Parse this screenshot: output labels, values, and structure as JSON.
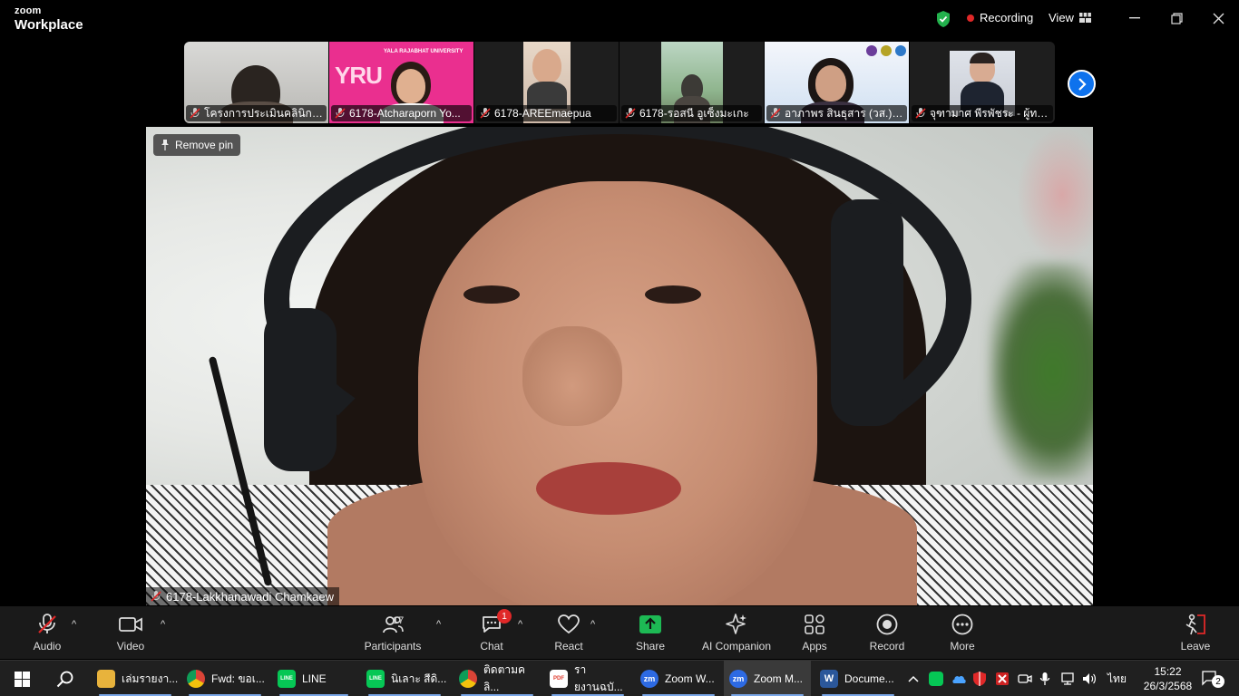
{
  "app": {
    "brand_top": "zoom",
    "brand_bottom": "Workplace"
  },
  "titlebar": {
    "recording_label": "Recording",
    "view_label": "View"
  },
  "gallery": {
    "tiles": [
      {
        "name": "โครงการประเมินคลินิกเทค..."
      },
      {
        "name": "6178-Atcharaporn Yo...",
        "banner_text": "YRU",
        "banner_small": "YALA RAJABHAT UNIVERSITY"
      },
      {
        "name": "6178-AREEmaepua"
      },
      {
        "name": "6178-รอสนี อูเซ็งมะเกะ"
      },
      {
        "name": "อาภาพร สินธุสาร (วส.)-..."
      },
      {
        "name": "จุฑามาศ พีรพัชระ - ผู้ทร..."
      }
    ]
  },
  "main_video": {
    "remove_pin_label": "Remove pin",
    "speaker_name": "6178-Lakkhanawadi Chamkaew"
  },
  "toolbar": {
    "audio": "Audio",
    "video": "Video",
    "participants": "Participants",
    "participants_count": "17",
    "chat": "Chat",
    "chat_badge": "1",
    "react": "React",
    "share": "Share",
    "ai_companion": "AI Companion",
    "apps": "Apps",
    "record": "Record",
    "more": "More",
    "leave": "Leave"
  },
  "taskbar": {
    "items": [
      {
        "label": "เล่มรายงา...",
        "icon": "folder-icon",
        "color": "#e8b33c"
      },
      {
        "label": "Fwd: ขอเ...",
        "icon": "chrome-icon",
        "color": "#db4437"
      },
      {
        "label": "LINE",
        "icon": "line-icon",
        "color": "#06c755"
      },
      {
        "label": "นิเลาะ สีดิ...",
        "icon": "line-icon",
        "color": "#06c755"
      },
      {
        "label": "ติดตามคลิ...",
        "icon": "chrome-icon",
        "color": "#db4437"
      },
      {
        "label": "รายงานฉบั...",
        "icon": "pdf-icon",
        "color": "#e03b2f"
      },
      {
        "label": "Zoom W...",
        "icon": "zoom-icon",
        "color": "#2d6ae3"
      },
      {
        "label": "Zoom M...",
        "icon": "zoom-icon",
        "color": "#2d6ae3"
      },
      {
        "label": "Docume...",
        "icon": "word-icon",
        "color": "#2b579a"
      }
    ],
    "zoom_icon_text": "zm",
    "word_icon_text": "W",
    "pdf_icon_text": "PDF",
    "line_icon_text": "LINE",
    "language": "ไทย",
    "time": "15:22",
    "date": "26/3/2568",
    "notifications": "2"
  }
}
